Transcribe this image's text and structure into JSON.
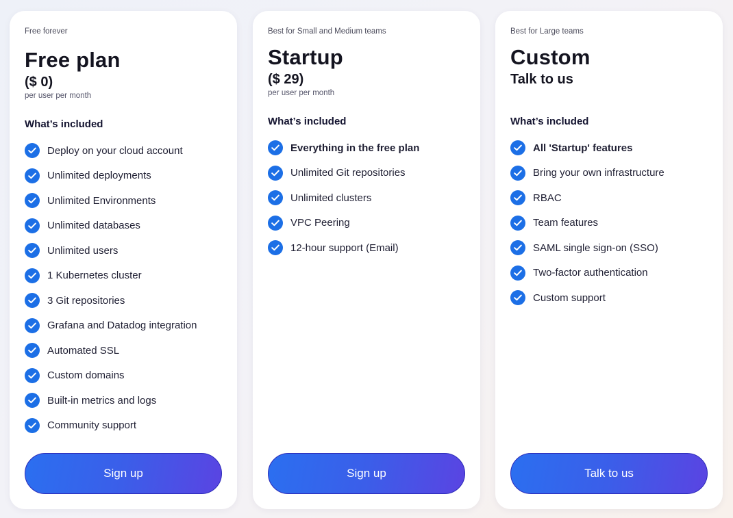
{
  "plans": [
    {
      "tagline": "Free forever",
      "name": "Free plan",
      "price": "($ 0)",
      "price_note": "per user per month",
      "included_heading": "What’s included",
      "features": [
        {
          "label": "Deploy on your cloud account",
          "bold": false
        },
        {
          "label": "Unlimited deployments",
          "bold": false
        },
        {
          "label": "Unlimited Environments",
          "bold": false
        },
        {
          "label": "Unlimited databases",
          "bold": false
        },
        {
          "label": "Unlimited users",
          "bold": false
        },
        {
          "label": "1 Kubernetes cluster",
          "bold": false
        },
        {
          "label": "3 Git repositories",
          "bold": false
        },
        {
          "label": "Grafana and Datadog integration",
          "bold": false
        },
        {
          "label": "Automated SSL",
          "bold": false
        },
        {
          "label": "Custom domains",
          "bold": false
        },
        {
          "label": "Built-in metrics and logs",
          "bold": false
        },
        {
          "label": "Community support",
          "bold": false
        }
      ],
      "cta_label": "Sign up"
    },
    {
      "tagline": "Best for Small and Medium teams",
      "name": "Startup",
      "price": "($ 29)",
      "price_note": "per user per month",
      "included_heading": "What’s included",
      "features": [
        {
          "label": "Everything in the free plan",
          "bold": true
        },
        {
          "label": "Unlimited Git repositories",
          "bold": false
        },
        {
          "label": "Unlimited clusters",
          "bold": false
        },
        {
          "label": "VPC Peering",
          "bold": false
        },
        {
          "label": "12-hour support (Email)",
          "bold": false
        }
      ],
      "cta_label": "Sign up"
    },
    {
      "tagline": "Best for Large teams",
      "name": "Custom",
      "price": "Talk to us",
      "price_note": "",
      "included_heading": "What’s included",
      "features": [
        {
          "label": "All 'Startup' features",
          "bold": true
        },
        {
          "label": "Bring your own infrastructure",
          "bold": false
        },
        {
          "label": "RBAC",
          "bold": false
        },
        {
          "label": "Team features",
          "bold": false
        },
        {
          "label": "SAML single sign-on (SSO)",
          "bold": false
        },
        {
          "label": "Two-factor authentication",
          "bold": false
        },
        {
          "label": "Custom support",
          "bold": false
        }
      ],
      "cta_label": "Talk to us"
    }
  ],
  "icons": {
    "feature_check": "check-circle-icon"
  },
  "colors": {
    "check_fill": "#1c6fe6",
    "cta_gradient_start": "#2b6ff0",
    "cta_gradient_end": "#5a44e2"
  }
}
